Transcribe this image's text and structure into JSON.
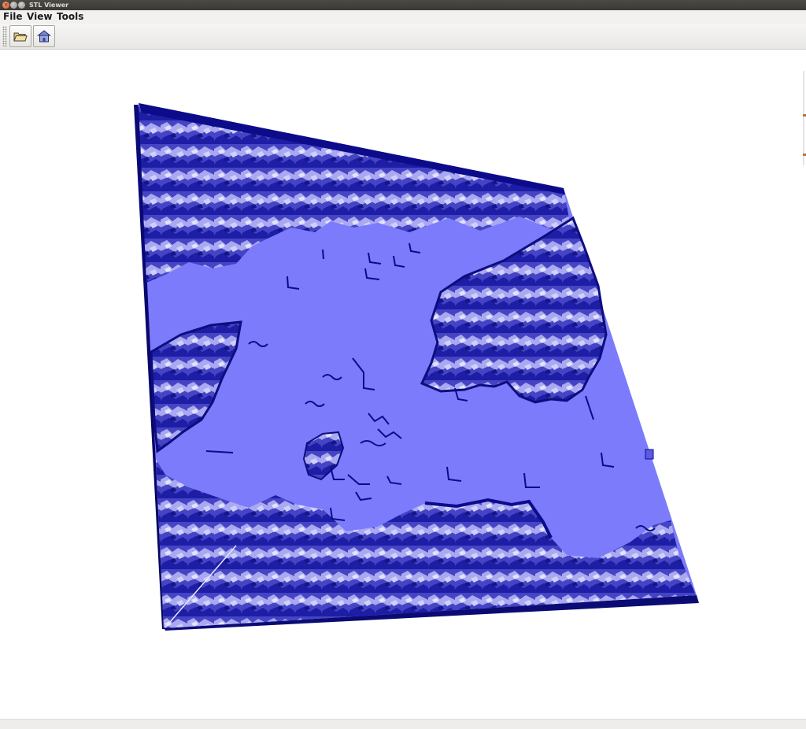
{
  "window": {
    "title": "STL Viewer"
  },
  "menu": {
    "file": "File",
    "view": "View",
    "tools": "Tools"
  },
  "toolbar": {
    "open_icon": "open-folder-icon",
    "home_icon": "home-icon"
  },
  "scene": {
    "model": "terrain-mesh",
    "colors": {
      "water": "#7b7bfb",
      "edge": "#0c0c8a",
      "terrain_dark": "#1a1a9c",
      "terrain_light": "#dcdcfb"
    }
  }
}
